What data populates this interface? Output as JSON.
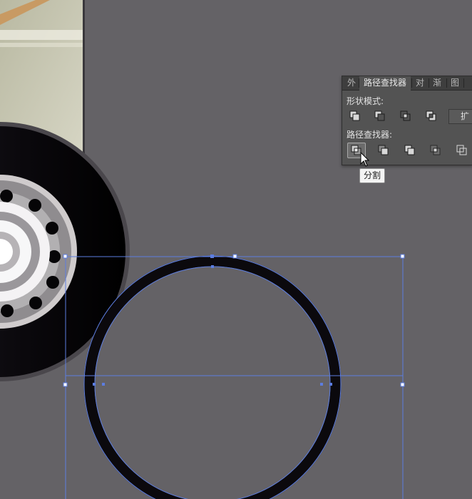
{
  "panel": {
    "tabs": [
      {
        "label": "外"
      },
      {
        "label": "路径查找器"
      },
      {
        "label": "对"
      },
      {
        "label": "渐"
      },
      {
        "label": "图"
      }
    ],
    "shape_modes_label": "形状模式:",
    "pathfinders_label": "路径查找器:",
    "expand_label": "扩"
  },
  "tooltip": {
    "text": "分割"
  },
  "icons": {
    "shape_modes": [
      "unite-icon",
      "minus-front-icon",
      "intersect-icon",
      "exclude-icon"
    ],
    "pathfinders": [
      "divide-icon",
      "trim-icon",
      "merge-icon",
      "crop-icon",
      "outline-icon"
    ]
  },
  "colors": {
    "canvas": "#646266",
    "panel": "#535353",
    "selection": "#5c7de0",
    "tire": "#0b090d"
  }
}
